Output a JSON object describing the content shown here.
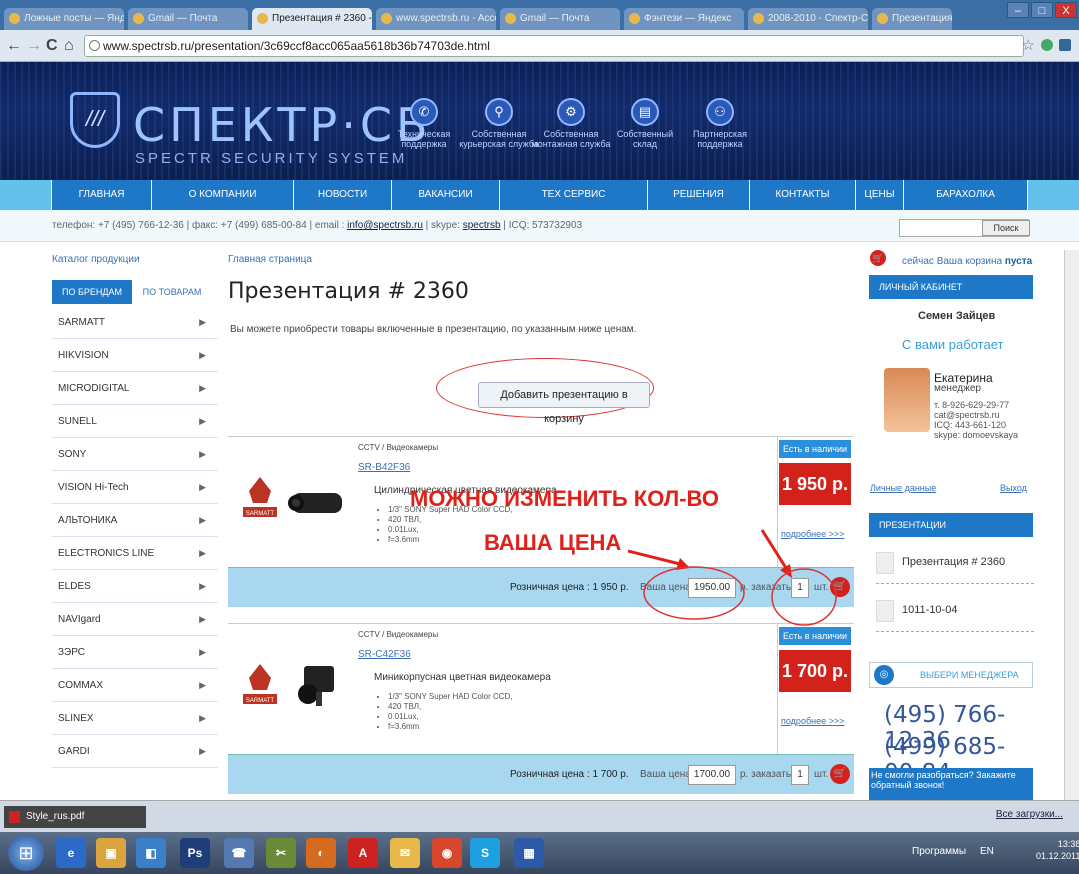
{
  "browser": {
    "tabs": [
      "Ложные посты — Яндекс",
      "Gmail — Почта",
      "Презентация # 2360 - Спектр",
      "www.spectrsb.ru - Accou",
      "Gmail — Почта",
      "Фэнтези — Яндекс",
      "2008-2010 - Спектр-СБ",
      "Презентация # 2360"
    ],
    "url": "www.spectrsb.ru/presentation/3c69ccf8acc065aa5618b36b74703de.html",
    "back": "←",
    "forward": "→",
    "reload": "C",
    "home": "⌂",
    "star": "☆",
    "minimize": "–",
    "maximize": "□",
    "close": "X"
  },
  "banner": {
    "shield_glyph": "///",
    "logo": "СПЕКТР·СБ",
    "subtitle": "SPECTR SECURITY SYSTEM",
    "icons": [
      {
        "label": "Техническая поддержка",
        "glyph": "✆"
      },
      {
        "label": "Собственная курьерская служба",
        "glyph": "⚲"
      },
      {
        "label": "Собственная монтажная служба",
        "glyph": "⚙"
      },
      {
        "label": "Собственный склад",
        "glyph": "▤"
      },
      {
        "label": "Партнерская поддержка",
        "glyph": "⚇"
      }
    ]
  },
  "menu": [
    "ГЛАВНАЯ",
    "О КОМПАНИИ",
    "НОВОСТИ",
    "ВАКАНСИИ",
    "ТЕХ СЕРВИС",
    "РЕШЕНИЯ",
    "КОНТАКТЫ",
    "ЦЕНЫ",
    "БАРАХОЛКА"
  ],
  "contacts": {
    "phone": "телефон: +7 (495) 766-12-36",
    "fax": "факс: +7 (499) 685-00-84",
    "email_label": "email :",
    "email": "info@spectrsb.ru",
    "skype_label": "skype:",
    "skype": "spectrsb",
    "icq": "ICQ: 573732903",
    "search_button": "Поиск"
  },
  "sidebar": {
    "title": "Каталог продукции",
    "tab_brands": "ПО БРЕНДАМ",
    "tab_products": "ПО ТОВАРАМ",
    "brands": [
      "SARMATT",
      "HIKVISION",
      "MICRODIGITAL",
      "SUNELL",
      "SONY",
      "VISION Hi-Tech",
      "АЛЬТОНИКА",
      "ELECTRONICS LINE",
      "ELDES",
      "NAVIgard",
      "ЗЭРС",
      "COMMAX",
      "SLINEX",
      "GARDI"
    ]
  },
  "main": {
    "breadcrumb": "Главная страница",
    "title": "Презентация # 2360",
    "intro": "Вы можете приобрести товары включенные в презентацию, по указанным ниже ценам.",
    "add_button": "Добавить презентацию в корзину",
    "annotation_qty": "МОЖНО ИЗМЕНИТЬ КОЛ-ВО",
    "annotation_price": "ВАША ЦЕНА",
    "products": [
      {
        "category": "CCTV / Видеокамеры",
        "sku": "SR-B42F36",
        "name": "Цилиндрическая цветная видеокамера",
        "specs": [
          "1/3\" SONY Super HAD Color CCD,",
          "420 ТВЛ,",
          "0.01Lux,",
          "f=3.6mm"
        ],
        "stock": "Есть в наличии",
        "price": "1 950 р.",
        "more": "подробнее >>>",
        "retail_label": "Розничная цена : 1 950 р.",
        "your_price_label": "Ваша цена",
        "your_price": "1950.00",
        "order_label": "р. заказать",
        "qty": "1",
        "unit": "шт.",
        "logo_text": "SARMATT"
      },
      {
        "category": "CCTV / Видеокамеры",
        "sku": "SR-C42F36",
        "name": "Миникорпусная цветная видеокамера",
        "specs": [
          "1/3\" SONY Super HAD Color CCD,",
          "420 ТВЛ,",
          "0.01Lux,",
          "f=3.6mm"
        ],
        "stock": "Есть в наличии",
        "price": "1 700 р.",
        "more": "подробнее >>>",
        "retail_label": "Розничная цена : 1 700 р.",
        "your_price_label": "Ваша цена",
        "your_price": "1700.00",
        "order_label": "р. заказать",
        "qty": "1",
        "unit": "шт.",
        "logo_text": "SARMATT"
      }
    ]
  },
  "right": {
    "cart_text": "сейчас Ваша корзина",
    "cart_status": "пуста",
    "cabinet_title": "ЛИЧНЫЙ КАБИНЕТ",
    "user_name": "Семен Зайцев",
    "works_with": "С вами работает",
    "manager_name": "Екатерина",
    "manager_role": "менеджер",
    "manager_phone": "т. 8-926-629-29-77",
    "manager_email": "cat@spectrsb.ru",
    "manager_icq": "ICQ: 443-661-120",
    "manager_skype": "skype: domoevskaya",
    "personal_data": "Личные данные",
    "logout": "Выход",
    "presentations_title": "ПРЕЗЕНТАЦИИ",
    "presentations": [
      "Презентация # 2360",
      "1011-10-04"
    ],
    "choose_manager": "ВЫБЕРИ МЕНЕДЖЕРА",
    "phone1": "(495) 766-12-36",
    "phone2": "(499) 685-00-84",
    "help_text": "Не смогли разобраться? Закажите обратный звонок!"
  },
  "downloads": {
    "file": "Style_rus.pdf",
    "all": "Все загрузки..."
  },
  "taskbar": {
    "icons": [
      "e",
      "▣",
      "◧",
      "Ps",
      "☎",
      "✂",
      "◐",
      "A",
      "✉",
      "◉",
      "S",
      "▦"
    ],
    "prog": "Программы",
    "lang": "EN",
    "time": "13:38",
    "date": "01.12.2011"
  }
}
